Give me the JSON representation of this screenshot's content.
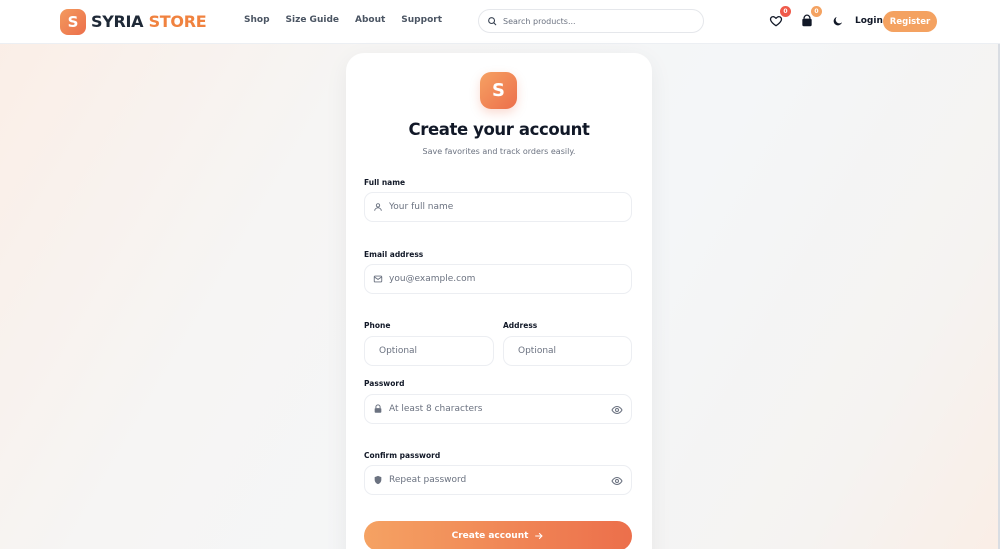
{
  "brand": {
    "mark": "S",
    "word1": "SYRIA",
    "word2": "STORE"
  },
  "nav": [
    "Shop",
    "Size Guide",
    "About",
    "Support"
  ],
  "search": {
    "placeholder": "Search products..."
  },
  "wishlist_count": "0",
  "cart_count": "0",
  "auth": {
    "login": "Login",
    "register": "Register"
  },
  "form": {
    "logo_mark": "S",
    "title": "Create your account",
    "subtitle": "Save favorites and track orders easily.",
    "full_name": {
      "label": "Full name",
      "placeholder": "Your full name"
    },
    "email": {
      "label": "Email address",
      "placeholder": "you@example.com"
    },
    "phone": {
      "label": "Phone",
      "placeholder": "Optional"
    },
    "address": {
      "label": "Address",
      "placeholder": "Optional"
    },
    "password": {
      "label": "Password",
      "placeholder": "At least 8 characters"
    },
    "confirm": {
      "label": "Confirm password",
      "placeholder": "Repeat password"
    },
    "submit": "Create account"
  },
  "colors": {
    "accent": "#f0823f",
    "badge_wishlist": "#ef5a4a",
    "badge_cart": "#f4a261"
  },
  "icons": [
    "search-icon",
    "heart-icon",
    "bag-icon",
    "moon-icon",
    "user-icon",
    "mail-icon",
    "phone-icon",
    "location-pin-icon",
    "lock-icon",
    "shield-icon",
    "eye-icon",
    "arrow-right-icon"
  ]
}
